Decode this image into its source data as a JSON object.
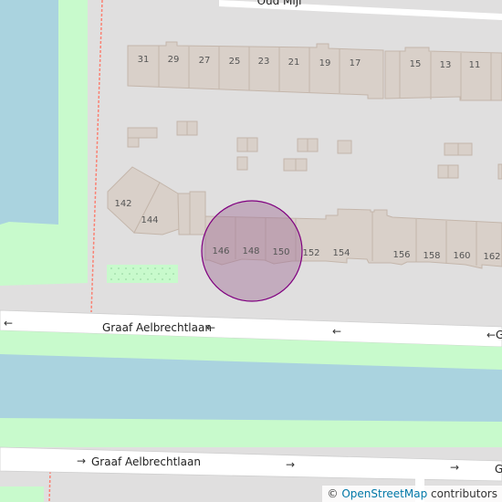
{
  "map": {
    "colors": {
      "background": "#e0dfdf",
      "water": "#aad3df",
      "park": "#c8facc",
      "building": "#d9d0c9",
      "building_stroke": "#c4b6ab",
      "road": "#ffffff",
      "footpath": "#fa8072",
      "marker_fill": "#a06e96",
      "marker_stroke": "#800080"
    },
    "top_street_label": "Oud Mijl",
    "road_labels": {
      "upper": "Graaf Aelbrechtlaan",
      "upper_arrow": "←",
      "lower": "Graaf Aelbrechtlaan",
      "lower_arrow": "→"
    },
    "oneway_arrows": {
      "left": "←",
      "right": "→",
      "edge_upper": "G",
      "edge_lower": "G"
    },
    "house_numbers_top": [
      "31",
      "29",
      "27",
      "25",
      "23",
      "21",
      "19",
      "17",
      "15",
      "13",
      "11"
    ],
    "house_numbers_bottom": [
      "142",
      "144",
      "146",
      "148",
      "150",
      "152",
      "154",
      "156",
      "158",
      "160",
      "162"
    ],
    "attribution": {
      "symbol": "©",
      "link_text": "OpenStreetMap",
      "suffix": "contributors"
    }
  }
}
